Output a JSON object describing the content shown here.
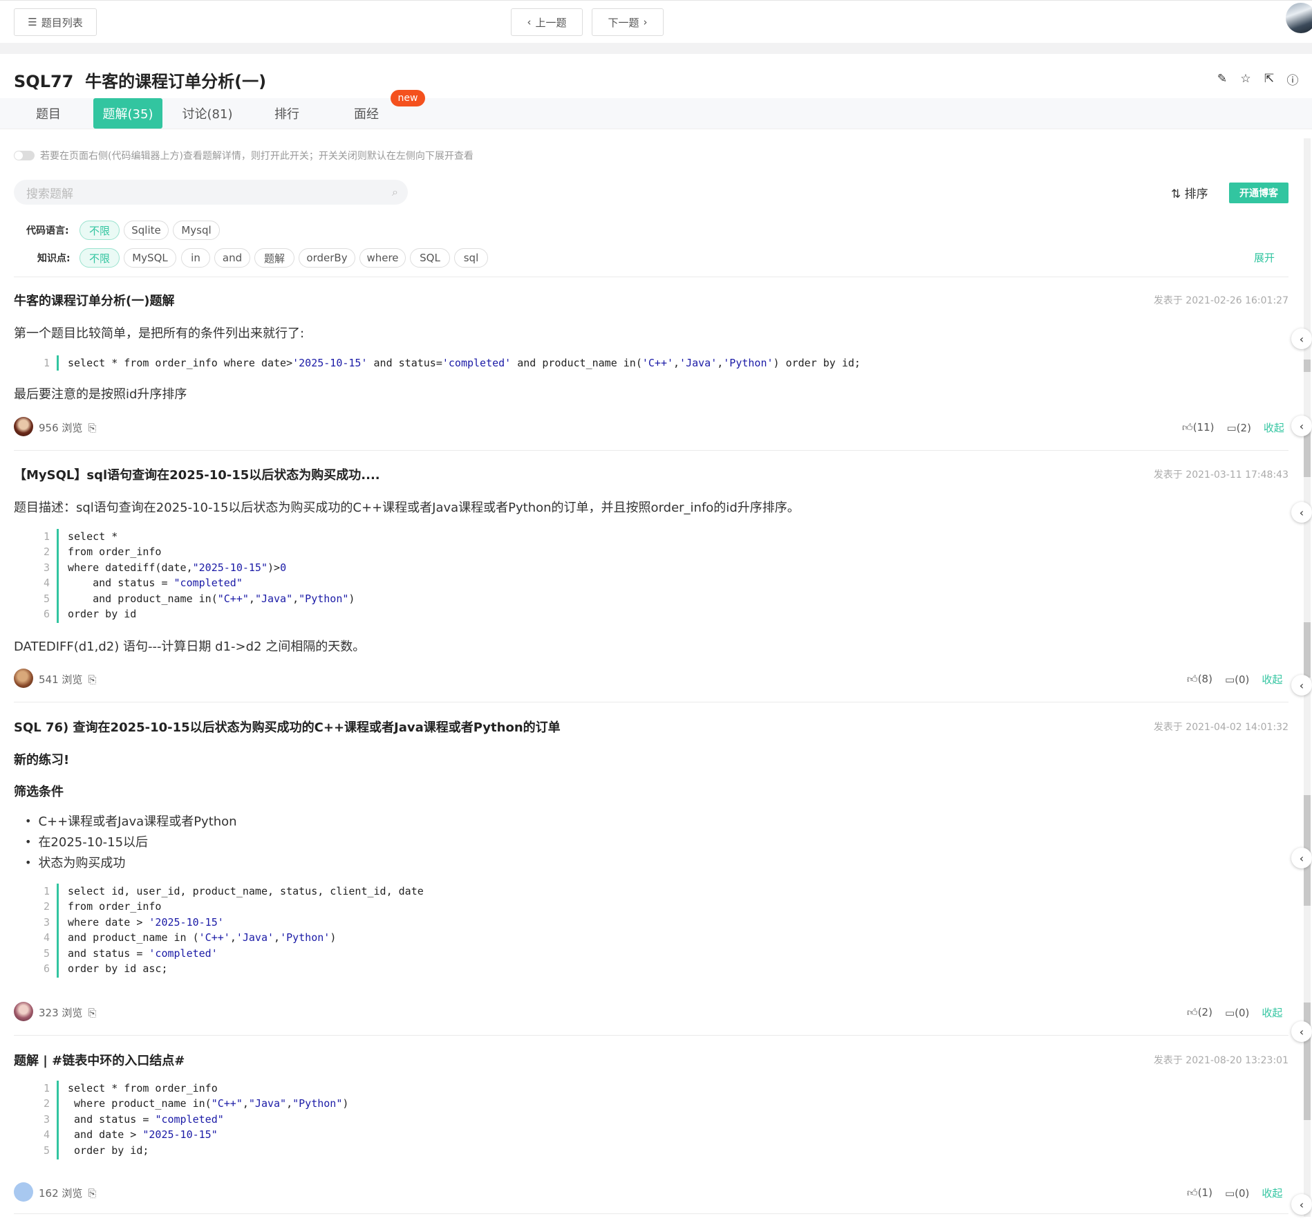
{
  "topbar": {
    "list_label": "题目列表",
    "prev_label": "上一题",
    "next_label": "下一题"
  },
  "problem": {
    "code": "SQL77",
    "title": "牛客的课程订单分析(一)"
  },
  "tabs": [
    {
      "label": "题目"
    },
    {
      "label": "题解(35)"
    },
    {
      "label": "讨论(81)"
    },
    {
      "label": "排行"
    },
    {
      "label": "面经"
    }
  ],
  "new_badge": "new",
  "hint": "若要在页面右侧(代码编辑器上方)查看题解详情，则打开此开关；开关关闭则默认在左侧向下展开查看",
  "search": {
    "placeholder": "搜索题解"
  },
  "sort_label": "排序",
  "blog_button": "开通博客",
  "filters": {
    "lang_label": "代码语言:",
    "lang_options": [
      "不限",
      "Sqlite",
      "Mysql"
    ],
    "topic_label": "知识点:",
    "topic_options": [
      "不限",
      "MySQL",
      "in",
      "and",
      "题解",
      "orderBy",
      "where",
      "SQL",
      "sql"
    ],
    "expand_label": "展开"
  },
  "posts": [
    {
      "title": "牛客的课程订单分析(一)题解",
      "date": "发表于 2021-02-26 16:01:27",
      "intro": "第一个题目比较简单，是把所有的条件列出来就行了:",
      "outro": "最后要注意的是按照id升序排序",
      "views": "956 浏览",
      "likes": "(11)",
      "comments": "(2)",
      "collapse": "收起"
    },
    {
      "title": "【MySQL】sql语句查询在2025-10-15以后状态为购买成功....",
      "date": "发表于 2021-03-11 17:48:43",
      "intro": "题目描述：sql语句查询在2025-10-15以后状态为购买成功的C++课程或者Java课程或者Python的订单，并且按照order_info的id升序排序。",
      "outro": "DATEDIFF(d1,d2) 语句---计算日期 d1->d2 之间相隔的天数。",
      "views": "541 浏览",
      "likes": "(8)",
      "comments": "(0)",
      "collapse": "收起"
    },
    {
      "title": "SQL 76) 查询在2025-10-15以后状态为购买成功的C++课程或者Java课程或者Python的订单",
      "date": "发表于 2021-04-02 14:01:32",
      "heading1": "新的练习!",
      "heading2": "筛选条件",
      "bullets": [
        "C++课程或者Java课程或者Python",
        "在2025-10-15以后",
        "状态为购买成功"
      ],
      "views": "323 浏览",
      "likes": "(2)",
      "comments": "(0)",
      "collapse": "收起"
    },
    {
      "title": "题解 | #链表中环的入口结点#",
      "date": "发表于 2021-08-20 13:23:01",
      "views": "162 浏览",
      "likes": "(1)",
      "comments": "(0)",
      "collapse": "收起"
    }
  ]
}
